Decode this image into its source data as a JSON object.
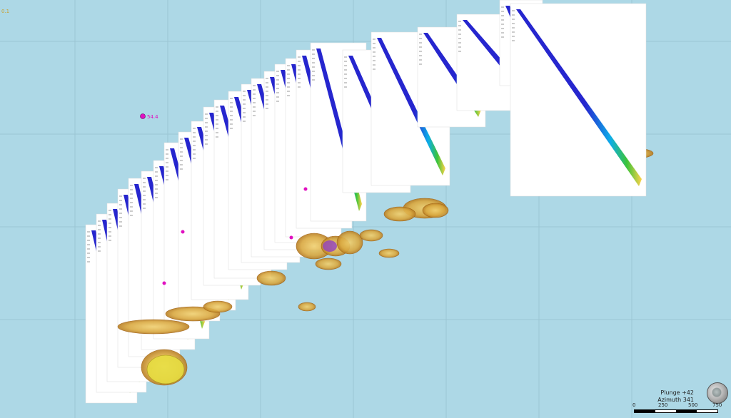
{
  "viewer": {
    "corner_label": "0.1",
    "collar_label": "54.4",
    "plunge": "Plunge +42",
    "azimuth": "Azimuth 341",
    "scale_ticks": [
      "0",
      "250",
      "500",
      "750"
    ]
  },
  "colors": {
    "background": "#add8e6",
    "grid": "#9cc6d4",
    "section": "#ffffff",
    "low": "#1a1acc",
    "mid": "#00a8e8",
    "high": "#30c030",
    "shell_fill": "#d9a840",
    "shell_edge": "#a06010",
    "pink": "#e010c0"
  }
}
